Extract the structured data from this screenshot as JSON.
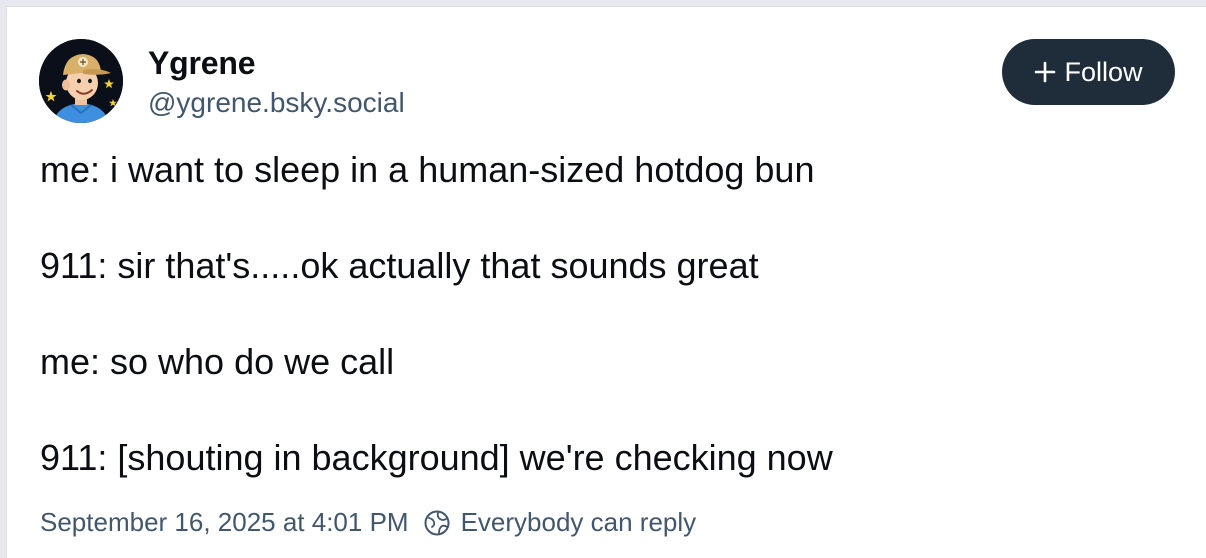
{
  "author": {
    "display_name": "Ygrene",
    "handle": "@ygrene.bsky.social",
    "avatar_icon": "cartoon-man-cap-avatar"
  },
  "follow_button": {
    "label": "Follow",
    "icon": "plus-icon",
    "background": "#1f2c3a",
    "text_color": "#ffffff"
  },
  "post": {
    "lines": [
      "me: i want to sleep in a human-sized hotdog bun",
      "911: sir that's.....ok actually that sounds great",
      "me: so who do we call",
      "911: [shouting in background] we're checking now"
    ]
  },
  "meta": {
    "timestamp": "September 16, 2025 at 4:01 PM",
    "reply_setting": "Everybody can reply",
    "reply_icon": "globe-reply-icon",
    "muted_color": "#42576c"
  }
}
